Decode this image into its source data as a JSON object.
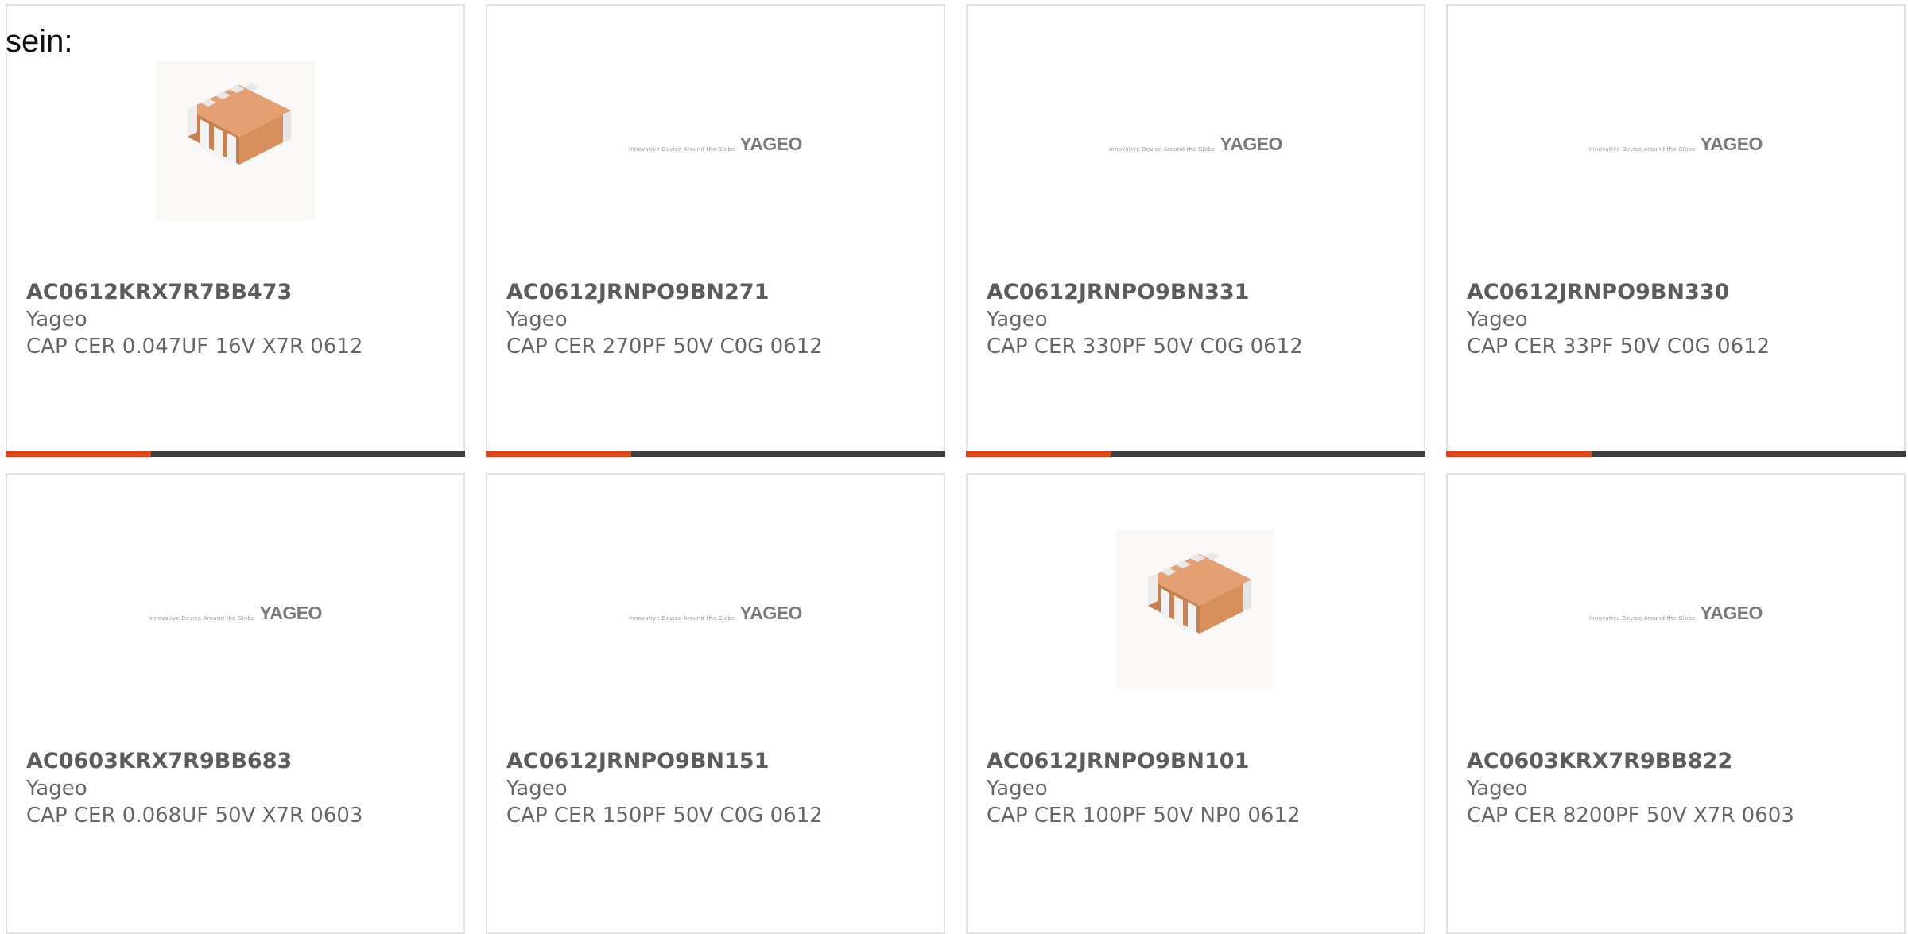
{
  "intro_text": "sein:",
  "products": [
    {
      "part_number": "AC0612KRX7R7BB473",
      "manufacturer": "Yageo",
      "description": "CAP CER 0.047UF 16V X7R 0612",
      "image": "chip-array-photo",
      "has_bar": true
    },
    {
      "part_number": "AC0612JRNPO9BN271",
      "manufacturer": "Yageo",
      "description": "CAP CER 270PF 50V C0G 0612",
      "image": "yageo-logo",
      "has_bar": true
    },
    {
      "part_number": "AC0612JRNPO9BN331",
      "manufacturer": "Yageo",
      "description": "CAP CER 330PF 50V C0G 0612",
      "image": "yageo-logo",
      "has_bar": true
    },
    {
      "part_number": "AC0612JRNPO9BN330",
      "manufacturer": "Yageo",
      "description": "CAP CER 33PF 50V C0G 0612",
      "image": "yageo-logo",
      "has_bar": true
    },
    {
      "part_number": "AC0603KRX7R9BB683",
      "manufacturer": "Yageo",
      "description": "CAP CER 0.068UF 50V X7R 0603",
      "image": "yageo-logo",
      "has_bar": false
    },
    {
      "part_number": "AC0612JRNPO9BN151",
      "manufacturer": "Yageo",
      "description": "CAP CER 150PF 50V C0G 0612",
      "image": "yageo-logo",
      "has_bar": false
    },
    {
      "part_number": "AC0612JRNPO9BN101",
      "manufacturer": "Yageo",
      "description": "CAP CER 100PF 50V NP0 0612",
      "image": "chip-array-photo",
      "has_bar": false
    },
    {
      "part_number": "AC0603KRX7R9BB822",
      "manufacturer": "Yageo",
      "description": "CAP CER 8200PF 50V X7R 0603",
      "image": "yageo-logo",
      "has_bar": false
    }
  ],
  "logo": {
    "brand": "YAGEO",
    "tagline": "Innovative Device Around the Globe"
  },
  "colors": {
    "accent": "#e24213",
    "bar": "#3e3e3e",
    "card_border": "#e3e3e3",
    "text": "#666666",
    "chip_body": "#d88f5c"
  }
}
